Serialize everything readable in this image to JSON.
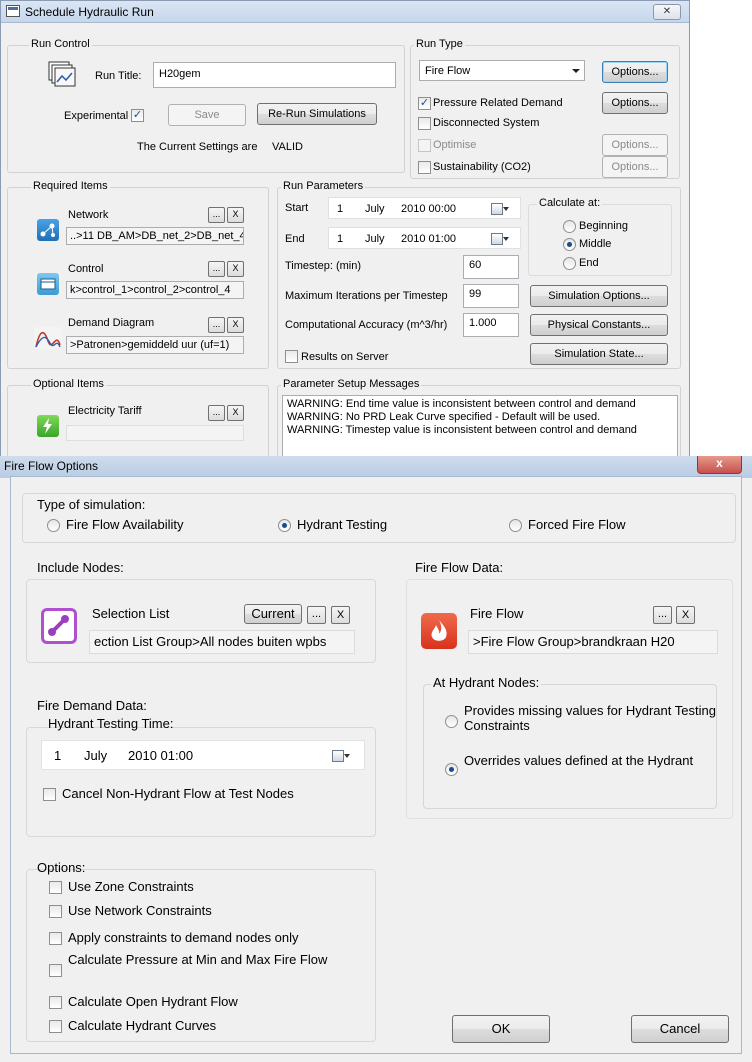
{
  "schedule_window": {
    "title": "Schedule Hydraulic Run",
    "close_glyph": "✕",
    "run_control": {
      "label": "Run Control",
      "run_title_label": "Run Title:",
      "run_title_value": "H20gem",
      "experimental_label": "Experimental",
      "experimental_checked": true,
      "save_label": "Save",
      "rerun_label": "Re-Run Simulations",
      "status_prefix": "The Current Settings are",
      "status_value": "VALID"
    },
    "run_type": {
      "label": "Run Type",
      "selected": "Fire Flow",
      "options_label": "Options...",
      "pressure_related_demand": {
        "label": "Pressure Related Demand",
        "checked": true,
        "options_label": "Options..."
      },
      "disconnected_system": {
        "label": "Disconnected System",
        "checked": false
      },
      "optimise": {
        "label": "Optimise",
        "checked": false,
        "enabled": false,
        "options_label": "Options..."
      },
      "sustainability": {
        "label": "Sustainability (CO2)",
        "checked": false,
        "options_label": "Options..."
      }
    },
    "required_items": {
      "label": "Required Items",
      "network": {
        "label": "Network",
        "value": "..>11 DB_AM>DB_net_2>DB_net_4"
      },
      "control": {
        "label": "Control",
        "value": "k>control_1>control_2>control_4"
      },
      "demand_diagram": {
        "label": "Demand Diagram",
        "value": ">Patronen>gemiddeld uur (uf=1)"
      },
      "browse_label": "...",
      "clear_label": "X"
    },
    "run_parameters": {
      "label": "Run Parameters",
      "start": {
        "label": "Start",
        "day": "1",
        "month": "July",
        "year_time": "2010 00:00"
      },
      "end": {
        "label": "End",
        "day": "1",
        "month": "July",
        "year_time": "2010 01:00"
      },
      "timestep_label": "Timestep: (min)",
      "timestep_value": "60",
      "max_iter_label": "Maximum Iterations per Timestep",
      "max_iter_value": "99",
      "accuracy_label": "Computational Accuracy (m^3/hr)",
      "accuracy_value": "1.000",
      "results_on_server_label": "Results on Server",
      "results_on_server_checked": false,
      "calculate_at": {
        "label": "Calculate at:",
        "options": [
          "Beginning",
          "Middle",
          "End"
        ],
        "selected": "Middle"
      },
      "simulation_options_label": "Simulation Options...",
      "physical_constants_label": "Physical Constants...",
      "simulation_state_label": "Simulation State..."
    },
    "optional_items": {
      "label": "Optional Items",
      "electricity_tariff": {
        "label": "Electricity Tariff",
        "value": ""
      }
    },
    "messages": {
      "label": "Parameter Setup Messages",
      "lines": [
        "WARNING: End time value is inconsistent between control and demand",
        "WARNING: No PRD Leak Curve specified - Default will be used.",
        "WARNING: Timestep value is inconsistent between control and demand"
      ]
    }
  },
  "fire_flow_window": {
    "title": "Fire Flow Options",
    "close_glyph": "x",
    "type_of_simulation": {
      "label": "Type of simulation:",
      "options": [
        "Fire Flow Availability",
        "Hydrant Testing",
        "Forced Fire Flow"
      ],
      "selected": "Hydrant Testing"
    },
    "include_nodes": {
      "label": "Include Nodes:",
      "selection_list_label": "Selection List",
      "current_label": "Current",
      "browse_label": "...",
      "clear_label": "X",
      "value": "ection List Group>All nodes buiten wpbs"
    },
    "fire_flow_data": {
      "label": "Fire Flow Data:",
      "fire_flow_label": "Fire Flow",
      "browse_label": "...",
      "clear_label": "X",
      "value": ">Fire Flow Group>brandkraan H20",
      "at_hydrant_nodes": {
        "label": "At Hydrant Nodes:",
        "options": [
          "Provides missing values for Hydrant Testing Constraints",
          "Overrides values defined at the Hydrant"
        ],
        "selected": 1
      }
    },
    "fire_demand_data": {
      "label": "Fire Demand Data:",
      "hydrant_testing_time_label": "Hydrant Testing Time:",
      "day": "1",
      "month": "July",
      "year_time": "2010 01:00",
      "cancel_non_hydrant_label": "Cancel Non-Hydrant Flow at Test Nodes",
      "cancel_non_hydrant_checked": false
    },
    "options": {
      "label": "Options:",
      "items": [
        {
          "label": "Use Zone Constraints",
          "checked": false
        },
        {
          "label": "Use Network Constraints",
          "checked": false
        },
        {
          "label": "Apply constraints to demand nodes only",
          "checked": false
        },
        {
          "label": "Calculate Pressure at Min and Max Fire Flow",
          "checked": false
        },
        {
          "label": "Calculate Open Hydrant Flow",
          "checked": false
        },
        {
          "label": "Calculate Hydrant Curves",
          "checked": false
        }
      ]
    },
    "ok_label": "OK",
    "cancel_label": "Cancel"
  },
  "colors": {
    "title_bar": "#c6d6ec",
    "window_bg": "#f0f0f0",
    "close_red": "#c75050",
    "check_blue": "#1c4e8a"
  }
}
